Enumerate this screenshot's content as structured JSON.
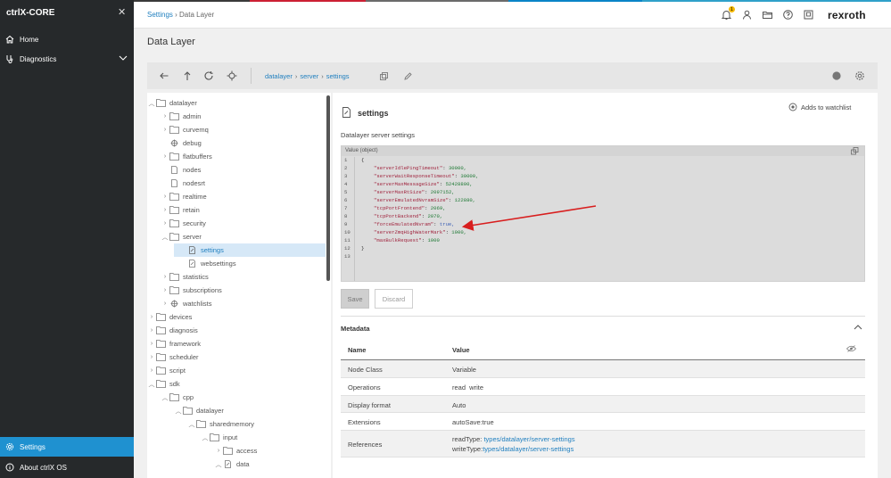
{
  "colors": {
    "accent": "#1f91d0",
    "link": "#1f7fbf",
    "annotation": "#d81e1e",
    "sidebar_bg": "#26292b"
  },
  "sidebar": {
    "title": "ctrlX-CORE",
    "close_icon": "close-icon",
    "items": [
      {
        "label": "Home",
        "icon": "home-icon"
      },
      {
        "label": "Diagnostics",
        "icon": "diagnostics-icon"
      },
      {
        "label": "Settings",
        "icon": "gear-icon"
      },
      {
        "label": "About ctrlX OS",
        "icon": "info-icon"
      }
    ]
  },
  "header": {
    "breadcrumb": {
      "root": "Settings",
      "current": "Data Layer"
    },
    "notification_count": "1",
    "logo": "rexroth"
  },
  "page": {
    "title": "Data Layer"
  },
  "toolbar": {
    "path": [
      "datalayer",
      "server",
      "settings"
    ]
  },
  "tree": {
    "nodes": [
      {
        "label": "datalayer"
      },
      {
        "label": "admin"
      },
      {
        "label": "curvemq"
      },
      {
        "label": "debug"
      },
      {
        "label": "flatbuffers"
      },
      {
        "label": "nodes"
      },
      {
        "label": "nodesrt"
      },
      {
        "label": "realtime"
      },
      {
        "label": "retain"
      },
      {
        "label": "security"
      },
      {
        "label": "server"
      },
      {
        "label": "settings"
      },
      {
        "label": "websettings"
      },
      {
        "label": "statistics"
      },
      {
        "label": "subscriptions"
      },
      {
        "label": "watchlists"
      },
      {
        "label": "devices"
      },
      {
        "label": "diagnosis"
      },
      {
        "label": "framework"
      },
      {
        "label": "scheduler"
      },
      {
        "label": "script"
      },
      {
        "label": "sdk"
      },
      {
        "label": "cpp"
      },
      {
        "label": "datalayer"
      },
      {
        "label": "sharedmemory"
      },
      {
        "label": "input"
      },
      {
        "label": "access"
      },
      {
        "label": "data"
      }
    ]
  },
  "detail": {
    "title": "settings",
    "watchlist_label": "Adds to watchlist",
    "subtitle": "Datalayer server settings",
    "editor_label": "Value (object)",
    "lines": [
      {
        "num": "1",
        "key": "",
        "val": "{"
      },
      {
        "num": "2",
        "key": "\"serverIdlePingTimeout\"",
        "val": "30000,"
      },
      {
        "num": "3",
        "key": "\"serverWaitResponseTimeout\"",
        "val": "30000,"
      },
      {
        "num": "4",
        "key": "\"serverMaxMessageSize\"",
        "val": "52428800,"
      },
      {
        "num": "5",
        "key": "\"serverMaxRtSize\"",
        "val": "2097152,"
      },
      {
        "num": "6",
        "key": "\"serverEmulatedNvramSize\"",
        "val": "122880,"
      },
      {
        "num": "7",
        "key": "\"tcpPortFrontend\"",
        "val": "2069,"
      },
      {
        "num": "8",
        "key": "\"tcpPortBackend\"",
        "val": "2070,"
      },
      {
        "num": "9",
        "key": "\"forceEmulatedNvram\"",
        "val": "true,"
      },
      {
        "num": "10",
        "key": "\"serverZmqHighWaterMark\"",
        "val": "1000,"
      },
      {
        "num": "11",
        "key": "\"maxBulkRequest\"",
        "val": "1000"
      },
      {
        "num": "12",
        "key": "",
        "val": "}"
      },
      {
        "num": "13",
        "key": "",
        "val": ""
      }
    ],
    "save_label": "Save",
    "discard_label": "Discard",
    "metadata_label": "Metadata",
    "meta_headers": {
      "name": "Name",
      "value": "Value"
    },
    "meta_rows": [
      {
        "name": "Node Class",
        "value": "Variable"
      },
      {
        "name": "Operations",
        "value": "read  write"
      },
      {
        "name": "Display format",
        "value": "Auto"
      },
      {
        "name": "Extensions",
        "value": "autoSave:true"
      }
    ],
    "references": {
      "name": "References",
      "read_label": "readType:",
      "read_link": "types/datalayer/server-settings",
      "write_label": "writeType:",
      "write_link": "types/datalayer/server-settings"
    }
  }
}
